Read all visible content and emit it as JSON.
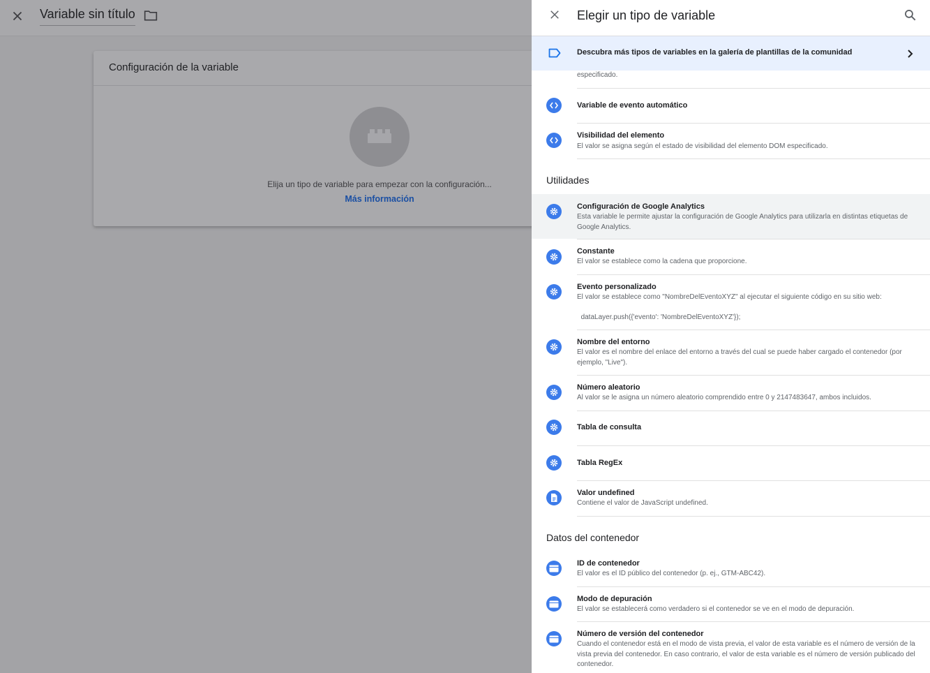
{
  "editor": {
    "title": "Variable sin título",
    "card_title": "Configuración de la variable",
    "hint": "Elija un tipo de variable para empezar con la configuración...",
    "learn_more": "Más información"
  },
  "panel": {
    "title": "Elegir un tipo de variable",
    "gallery_text": "Descubra más tipos de variables en la galería de plantillas de la comunidad",
    "cut_off_description": "especificado.",
    "page_elements_items": [
      {
        "name": "Variable de evento automático",
        "description": ""
      },
      {
        "name": "Visibilidad del elemento",
        "description": "El valor se asigna según el estado de visibilidad del elemento DOM especificado."
      }
    ],
    "utilities_heading": "Utilidades",
    "utilities_items": [
      {
        "name": "Configuración de Google Analytics",
        "description": "Esta variable le permite ajustar la configuración de Google Analytics para utilizarla en distintas etiquetas de Google Analytics."
      },
      {
        "name": "Constante",
        "description": "El valor se establece como la cadena que proporcione."
      },
      {
        "name": "Evento personalizado",
        "description": "El valor se establece como \"NombreDelEventoXYZ\" al ejecutar el siguiente código en su sitio web:",
        "code": "  dataLayer.push({'evento': 'NombreDelEventoXYZ'});"
      },
      {
        "name": "Nombre del entorno",
        "description": "El valor es el nombre del enlace del entorno a través del cual se puede haber cargado el contenedor (por ejemplo, \"Live\")."
      },
      {
        "name": "Número aleatorio",
        "description": "Al valor se le asigna un número aleatorio comprendido entre 0 y 2147483647, ambos incluidos."
      },
      {
        "name": "Tabla de consulta",
        "description": ""
      },
      {
        "name": "Tabla RegEx",
        "description": ""
      },
      {
        "name": "Valor undefined",
        "description": "Contiene el valor de JavaScript undefined."
      }
    ],
    "container_heading": "Datos del contenedor",
    "container_items": [
      {
        "name": "ID de contenedor",
        "description": "El valor es el ID público del contenedor (p. ej., GTM-ABC42)."
      },
      {
        "name": "Modo de depuración",
        "description": "El valor se establecerá como verdadero si el contenedor se ve en el modo de depuración."
      },
      {
        "name": "Número de versión del contenedor",
        "description": "Cuando el contenedor está en el modo de vista previa, el valor de esta variable es el número de versión de la vista previa del contenedor. En caso contrario, el valor de esta variable es el número de versión publicado del contenedor."
      }
    ]
  },
  "icons": {
    "close": "close-icon",
    "folder": "folder-icon",
    "search": "search-icon",
    "gallery": "tag-icon",
    "chevron": "chevron-right-icon",
    "page_element": "code-icon",
    "utility": "gear-icon",
    "undefined": "document-icon",
    "container": "browser-window-icon"
  },
  "colors": {
    "accent": "#3c7bea",
    "gallery_bg": "#e8f0fe",
    "overlay": "#a3a3a6"
  }
}
